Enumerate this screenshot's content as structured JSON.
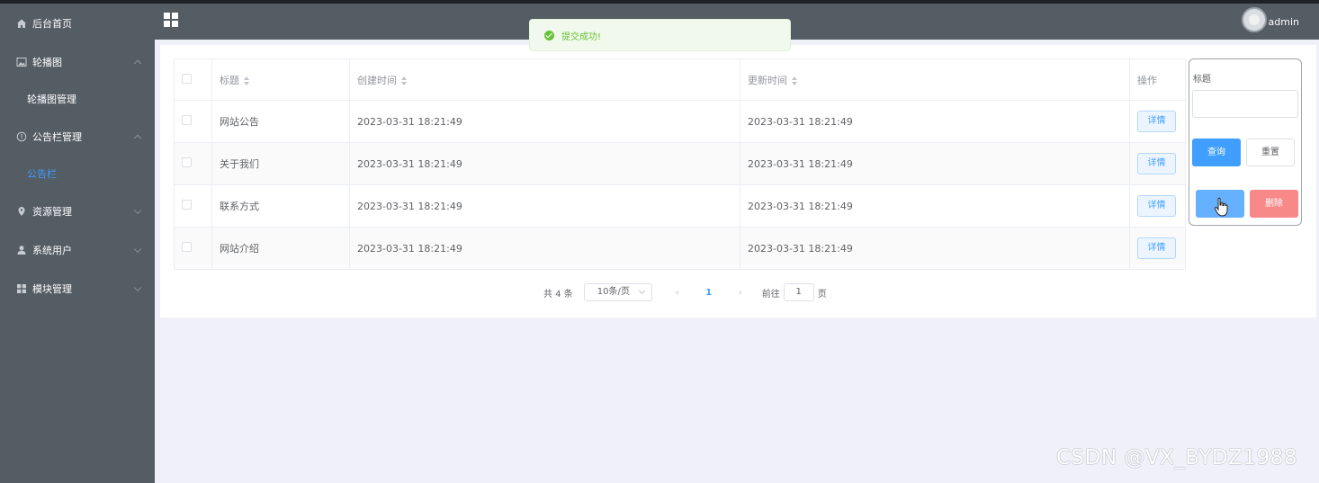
{
  "header": {
    "title": "",
    "username": "admin"
  },
  "toast": {
    "message": "提交成功!"
  },
  "sidebar": {
    "items": [
      {
        "label": "后台首页",
        "icon": "home-icon"
      },
      {
        "label": "轮播图",
        "icon": "image-icon",
        "expanded": true,
        "children": [
          {
            "label": "轮播图管理"
          }
        ]
      },
      {
        "label": "公告栏管理",
        "icon": "info-icon",
        "expanded": true,
        "children": [
          {
            "label": "公告栏",
            "active": true
          }
        ]
      },
      {
        "label": "资源管理",
        "icon": "location-icon",
        "expanded": false
      },
      {
        "label": "系统用户",
        "icon": "user-icon",
        "expanded": false
      },
      {
        "label": "模块管理",
        "icon": "grid-icon",
        "expanded": false
      }
    ]
  },
  "table": {
    "columns": [
      "标题",
      "创建时间",
      "更新时间",
      "操作"
    ],
    "detail_label": "详情",
    "rows": [
      {
        "title": "网站公告",
        "created": "2023-03-31 18:21:49",
        "updated": "2023-03-31 18:21:49"
      },
      {
        "title": "关于我们",
        "created": "2023-03-31 18:21:49",
        "updated": "2023-03-31 18:21:49"
      },
      {
        "title": "联系方式",
        "created": "2023-03-31 18:21:49",
        "updated": "2023-03-31 18:21:49"
      },
      {
        "title": "网站介绍",
        "created": "2023-03-31 18:21:49",
        "updated": "2023-03-31 18:21:49"
      }
    ]
  },
  "pagination": {
    "total_text": "共 4 条",
    "page_size": "10条/页",
    "current_page": "1",
    "goto_prefix": "前往",
    "goto_value": "1",
    "goto_suffix": "页"
  },
  "filter": {
    "title_label": "标题",
    "title_value": "",
    "query_label": "查询",
    "reset_label": "重置",
    "add_label": "",
    "delete_label": "删除"
  },
  "watermark": "CSDN @VX_BYDZ1988",
  "colors": {
    "sidebar_bg": "#545c64",
    "primary": "#409eff",
    "success": "#67c23a",
    "danger": "#f78989"
  }
}
